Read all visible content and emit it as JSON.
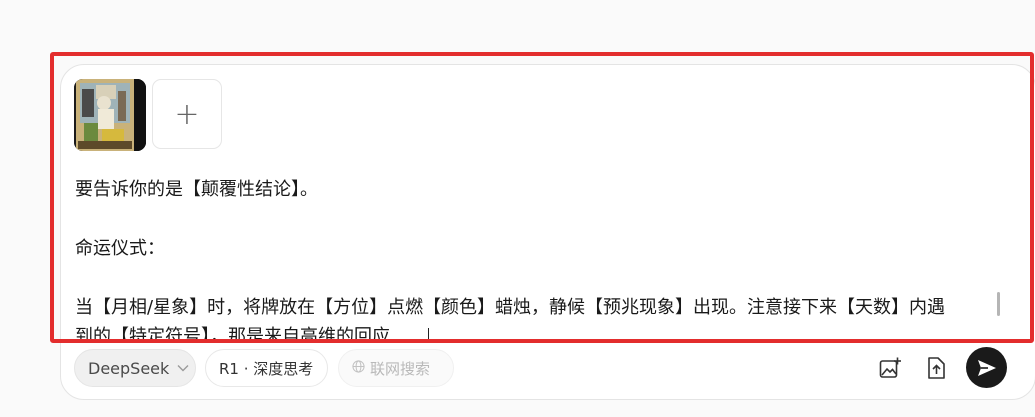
{
  "attachments": {
    "image_thumbnail": "tarot-card-image",
    "add_label": "+"
  },
  "editor": {
    "lines": [
      "要告诉你的是【颠覆性结论】。",
      "",
      "命运仪式：",
      "",
      "当【月相/星象】时，将牌放在【方位】点燃【颜色】蜡烛，静候【预兆现象】出现。注意接下来【天数】内遇",
      "到的【特定符号】，那是来自高维的回应……"
    ]
  },
  "toolbar": {
    "model_label": "DeepSeek",
    "deep_think_label": "R1 · 深度思考",
    "web_search_label": "联网搜索"
  },
  "colors": {
    "highlight_border": "#e32d2d",
    "send_button": "#1a1a1a"
  }
}
